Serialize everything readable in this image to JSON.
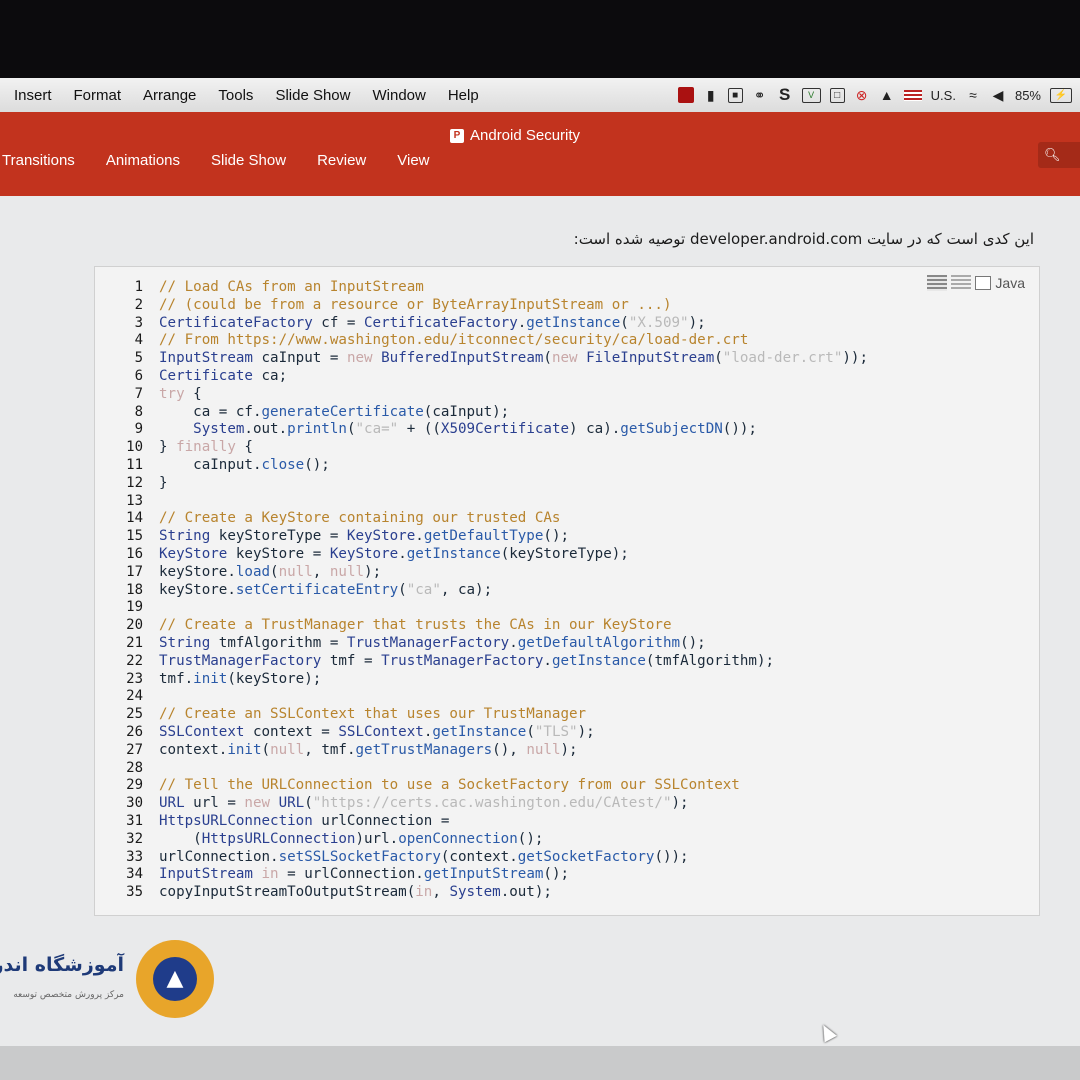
{
  "menubar": {
    "items": [
      "Insert",
      "Format",
      "Arrange",
      "Tools",
      "Slide Show",
      "Window",
      "Help"
    ],
    "status": {
      "input_source": "U.S.",
      "battery": "85%"
    }
  },
  "ribbon": {
    "doc_title": "Android Security",
    "tabs": [
      "Transitions",
      "Animations",
      "Slide Show",
      "Review",
      "View"
    ],
    "accent_color": "#c2331e",
    "search_icon": "search-icon"
  },
  "slide": {
    "intro_text": "این کدی است که در سایت developer.android.com توصیه شده است:",
    "code_block": {
      "language": "Java",
      "line_numbers": [
        "1",
        "2",
        "3",
        "4",
        "5",
        "6",
        "7",
        "8",
        "9",
        "10",
        "11",
        "12",
        "13",
        "14",
        "15",
        "16",
        "17",
        "18",
        "19",
        "20",
        "21",
        "22",
        "23",
        "24",
        "25",
        "26",
        "27",
        "28",
        "29",
        "30",
        "31",
        "32",
        "33",
        "34",
        "35"
      ],
      "lines": [
        "// Load CAs from an InputStream",
        "// (could be from a resource or ByteArrayInputStream or ...)",
        "CertificateFactory cf = CertificateFactory.getInstance(\"X.509\");",
        "// From https://www.washington.edu/itconnect/security/ca/load-der.crt",
        "InputStream caInput = new BufferedInputStream(new FileInputStream(\"load-der.crt\"));",
        "Certificate ca;",
        "try {",
        "    ca = cf.generateCertificate(caInput);",
        "    System.out.println(\"ca=\" + ((X509Certificate) ca).getSubjectDN());",
        "} finally {",
        "    caInput.close();",
        "}",
        "",
        "// Create a KeyStore containing our trusted CAs",
        "String keyStoreType = KeyStore.getDefaultType();",
        "KeyStore keyStore = KeyStore.getInstance(keyStoreType);",
        "keyStore.load(null, null);",
        "keyStore.setCertificateEntry(\"ca\", ca);",
        "",
        "// Create a TrustManager that trusts the CAs in our KeyStore",
        "String tmfAlgorithm = TrustManagerFactory.getDefaultAlgorithm();",
        "TrustManagerFactory tmf = TrustManagerFactory.getInstance(tmfAlgorithm);",
        "tmf.init(keyStore);",
        "",
        "// Create an SSLContext that uses our TrustManager",
        "SSLContext context = SSLContext.getInstance(\"TLS\");",
        "context.init(null, tmf.getTrustManagers(), null);",
        "",
        "// Tell the URLConnection to use a SocketFactory from our SSLContext",
        "URL url = new URL(\"https://certs.cac.washington.edu/CAtest/\");",
        "HttpsURLConnection urlConnection =",
        "    (HttpsURLConnection)url.openConnection();",
        "urlConnection.setSSLSocketFactory(context.getSocketFactory());",
        "InputStream in = urlConnection.getInputStream();",
        "copyInputStreamToOutputStream(in, System.out);"
      ]
    },
    "logo": {
      "title": "آموزشگاه اندرو",
      "subtitle": "مرکز پرورش متخصص توسعه"
    }
  }
}
